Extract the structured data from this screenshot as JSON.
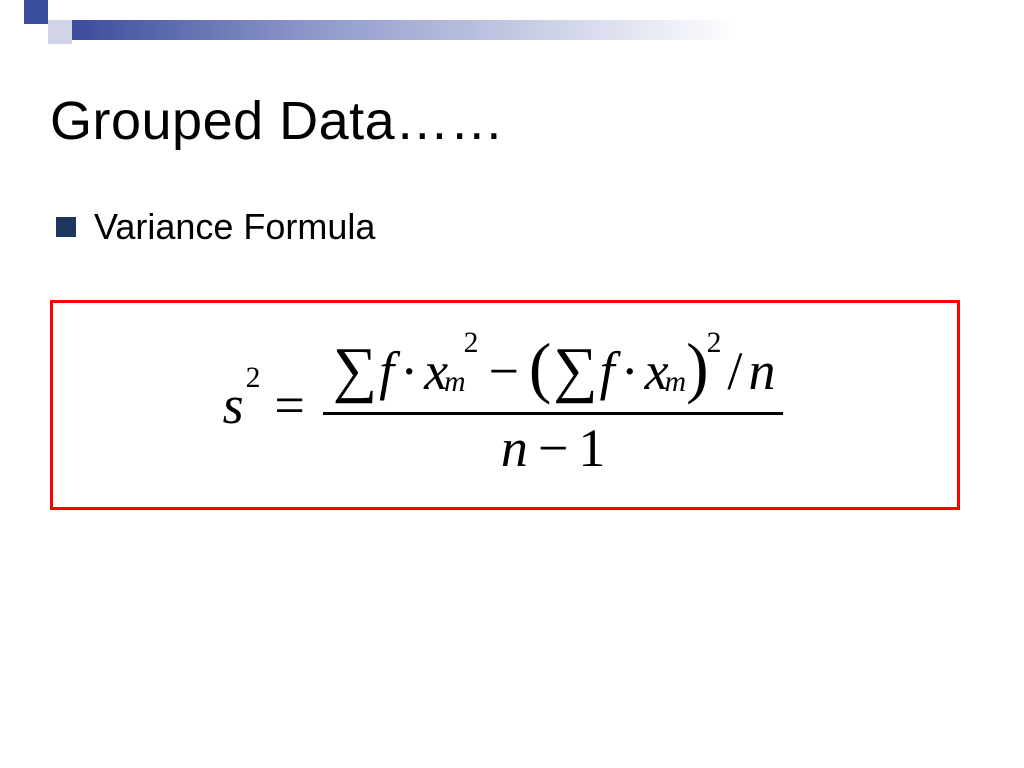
{
  "slide": {
    "title": "Grouped Data……",
    "bullet": "Variance Formula"
  },
  "formula": {
    "lhs_var": "s",
    "lhs_exp": "2",
    "eq": "=",
    "sum": "∑",
    "f": "f",
    "dot": "·",
    "x": "x",
    "sub_m": "m",
    "exp2": "2",
    "minus": "−",
    "lparen": "(",
    "rparen": ")",
    "slash": "/",
    "n": "n",
    "den_n": "n",
    "den_minus": "−",
    "den_one": "1"
  }
}
